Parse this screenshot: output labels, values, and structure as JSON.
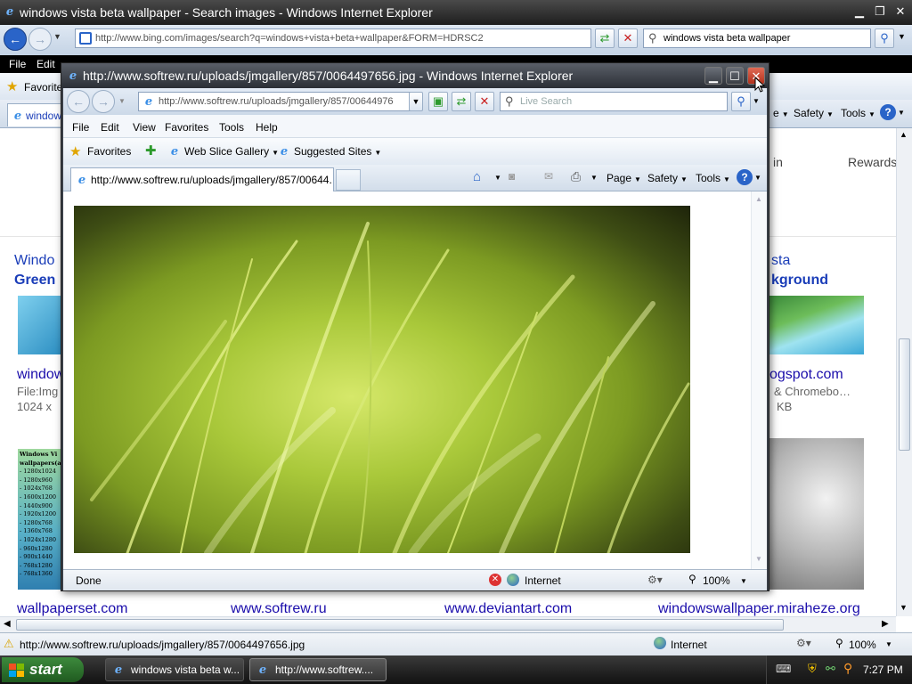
{
  "bg_window": {
    "title": "windows vista beta wallpaper - Search images - Windows Internet Explorer",
    "address": "http://www.bing.com/images/search?q=windows+vista+beta+wallpaper&FORM=HDRSC2",
    "search_value": "windows vista beta wallpaper",
    "menu": {
      "file": "File",
      "edit": "Edit"
    },
    "favorites_label": "Favorite",
    "tab_label": "windows",
    "toolbar": {
      "safety": "Safety",
      "tools": "Tools"
    },
    "page_header": {
      "sign_in": "in",
      "rewards": "Rewards"
    },
    "results": {
      "left_title_1": "Windo",
      "left_title_2": "Green",
      "left_link": "window",
      "left_file": "File:Img",
      "left_size": "1024 x",
      "right_title_1": "sta",
      "right_title_2": "kground",
      "right_link": "ogspot.com",
      "right_desc": "& Chromebo…",
      "right_size": "KB",
      "thumb_list": [
        "Windows Vi",
        "wallpapers(a",
        "- 1280x1024",
        "- 1280x960",
        "- 1024x768",
        "- 1600x1200",
        "- 1440x900",
        "- 1920x1200",
        "- 1280x768",
        "- 1360x768",
        "- 1024x1280",
        "- 960x1280",
        "- 900x1440",
        "- 768x1280",
        "- 768x1360"
      ]
    },
    "source_links": [
      "wallpaperset.com",
      "www.softrew.ru",
      "www.deviantart.com",
      "windowswallpaper.miraheze.org"
    ],
    "status": {
      "url": "http://www.softrew.ru/uploads/jmgallery/857/0064497656.jpg",
      "zone": "Internet",
      "zoom": "100%"
    }
  },
  "popup": {
    "title": "http://www.softrew.ru/uploads/jmgallery/857/0064497656.jpg - Windows Internet Explorer",
    "address": "http://www.softrew.ru/uploads/jmgallery/857/00644976",
    "search_placeholder": "Live Search",
    "menu": {
      "file": "File",
      "edit": "Edit",
      "view": "View",
      "favorites": "Favorites",
      "tools": "Tools",
      "help": "Help"
    },
    "favorites": {
      "favorites": "Favorites",
      "web_slice": "Web Slice Gallery",
      "suggested": "Suggested Sites"
    },
    "tab_label": "http://www.softrew.ru/uploads/jmgallery/857/00644...",
    "toolbar": {
      "page": "Page",
      "safety": "Safety",
      "tools": "Tools"
    },
    "status": {
      "text": "Done",
      "zone": "Internet",
      "zoom": "100%"
    }
  },
  "taskbar": {
    "start": "start",
    "items": [
      "windows vista beta w...",
      "http://www.softrew...."
    ],
    "clock": "7:27 PM"
  },
  "colors": {
    "link": "#1a0dab",
    "result_title": "#1a3db8",
    "grass_light": "#a9c83a",
    "grass_dark": "#2f3a10"
  }
}
